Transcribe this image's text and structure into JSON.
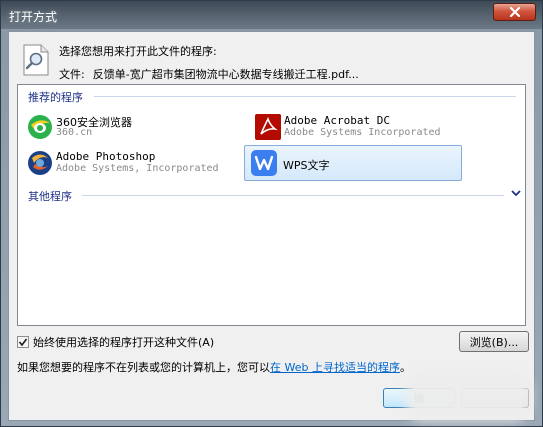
{
  "window": {
    "title": "打开方式"
  },
  "intro": {
    "prompt": "选择您想用来打开此文件的程序:",
    "file_label": "文件:",
    "file_name": "反馈单-宽广超市集团物流中心数据专线搬迁工程.pdf..."
  },
  "groups": {
    "recommended": "推荐的程序",
    "other": "其他程序"
  },
  "apps": [
    {
      "name": "360安全浏览器",
      "publisher": "360.cn",
      "icon": "360-browser-icon"
    },
    {
      "name": "Adobe Acrobat DC",
      "publisher": "Adobe Systems Incorporated",
      "icon": "acrobat-icon"
    },
    {
      "name": "Adobe Photoshop",
      "publisher": "Adobe Systems, Incorporated",
      "icon": "photoshop-icon"
    },
    {
      "name": "WPS文字",
      "publisher": "",
      "icon": "wps-writer-icon",
      "selected": true
    }
  ],
  "always_use": {
    "label": "始终使用选择的程序打开这种文件(A)",
    "checked": true
  },
  "browse_button": "浏览(B)...",
  "help": {
    "text": "如果您想要的程序不在列表或您的计算机上，您可以",
    "link": "在 Web 上寻找适当的程序",
    "suffix": "。"
  },
  "ok_button": "确",
  "colors": {
    "link": "#0066cc",
    "group_heading": "#1e3287",
    "selection_border": "#84acdd",
    "close_button": "#c8412a"
  }
}
